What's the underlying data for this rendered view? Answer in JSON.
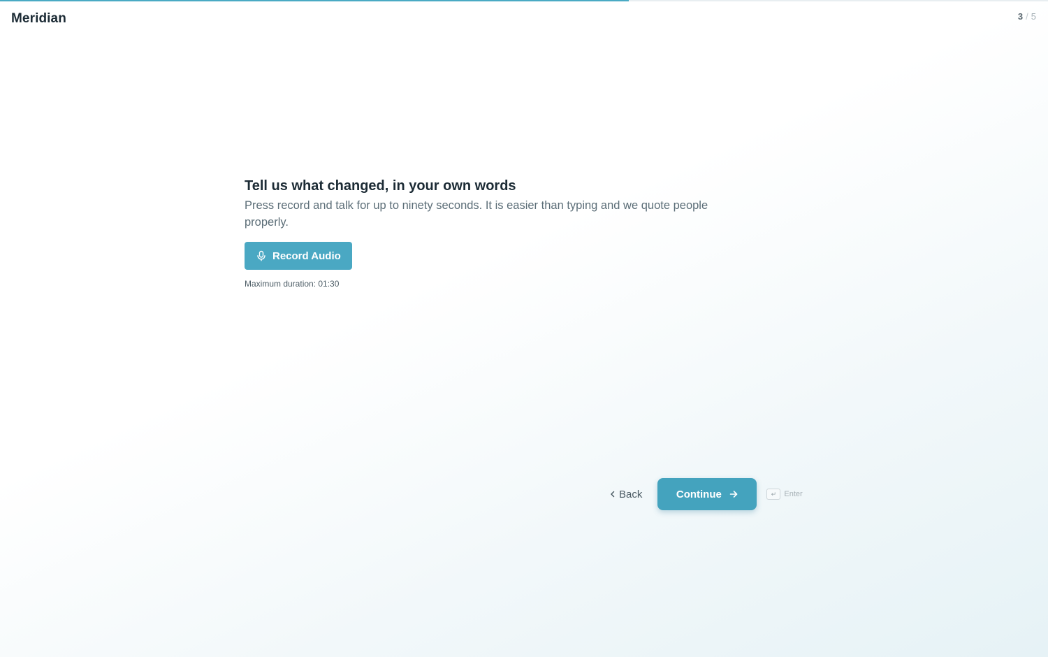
{
  "header": {
    "brand": "Meridian",
    "progress": {
      "current": "3",
      "separator": "/",
      "total": "5",
      "fraction": 0.6
    }
  },
  "question": {
    "title": "Tell us what changed, in your own words",
    "description": "Press record and talk for up to ninety seconds. It is easier than typing and we quote people properly.",
    "record_button_label": "Record Audio",
    "hint": "Maximum duration: 01:30"
  },
  "navigation": {
    "back_label": "Back",
    "continue_label": "Continue",
    "enter_key_glyph": "↵",
    "enter_label": "Enter"
  },
  "colors": {
    "accent": "#4aa8c3",
    "text_primary": "#1c2b35",
    "text_secondary": "#5b6d77"
  },
  "icons": [
    "microphone-icon",
    "chevron-left-icon",
    "arrow-right-icon",
    "enter-key-icon"
  ]
}
